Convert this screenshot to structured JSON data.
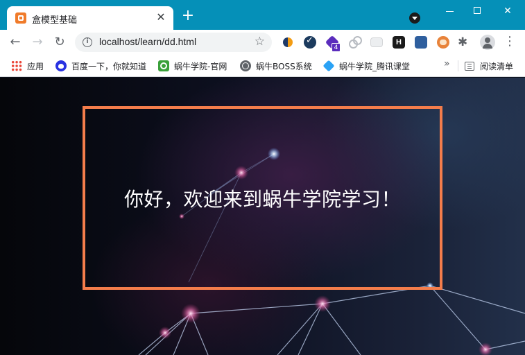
{
  "window": {
    "tab_title": "盒模型基础",
    "tab_close": "✕",
    "new_tab": "+"
  },
  "toolbar": {
    "back": "←",
    "forward": "→",
    "reload": "↻",
    "info": "i",
    "url": "localhost/learn/dd.html",
    "star": "☆",
    "extension_badge": "4",
    "ext_h_label": "H",
    "menu": "⋮",
    "puzzle": "✱"
  },
  "bookmarks": {
    "items": [
      {
        "label": "应用",
        "icon": "apps-icon"
      },
      {
        "label": "百度一下，你就知道",
        "icon": "baidu-icon"
      },
      {
        "label": "蜗牛学院-官网",
        "icon": "snail-icon"
      },
      {
        "label": "蜗牛BOSS系统",
        "icon": "globe-icon"
      },
      {
        "label": "蜗牛学院_腾讯课堂",
        "icon": "tencent-classroom-icon"
      }
    ],
    "more": "»",
    "reading_list": "阅读清单"
  },
  "page": {
    "greeting": "你好，欢迎来到蜗牛学院学习！",
    "accent_color": "#f47d4b"
  }
}
